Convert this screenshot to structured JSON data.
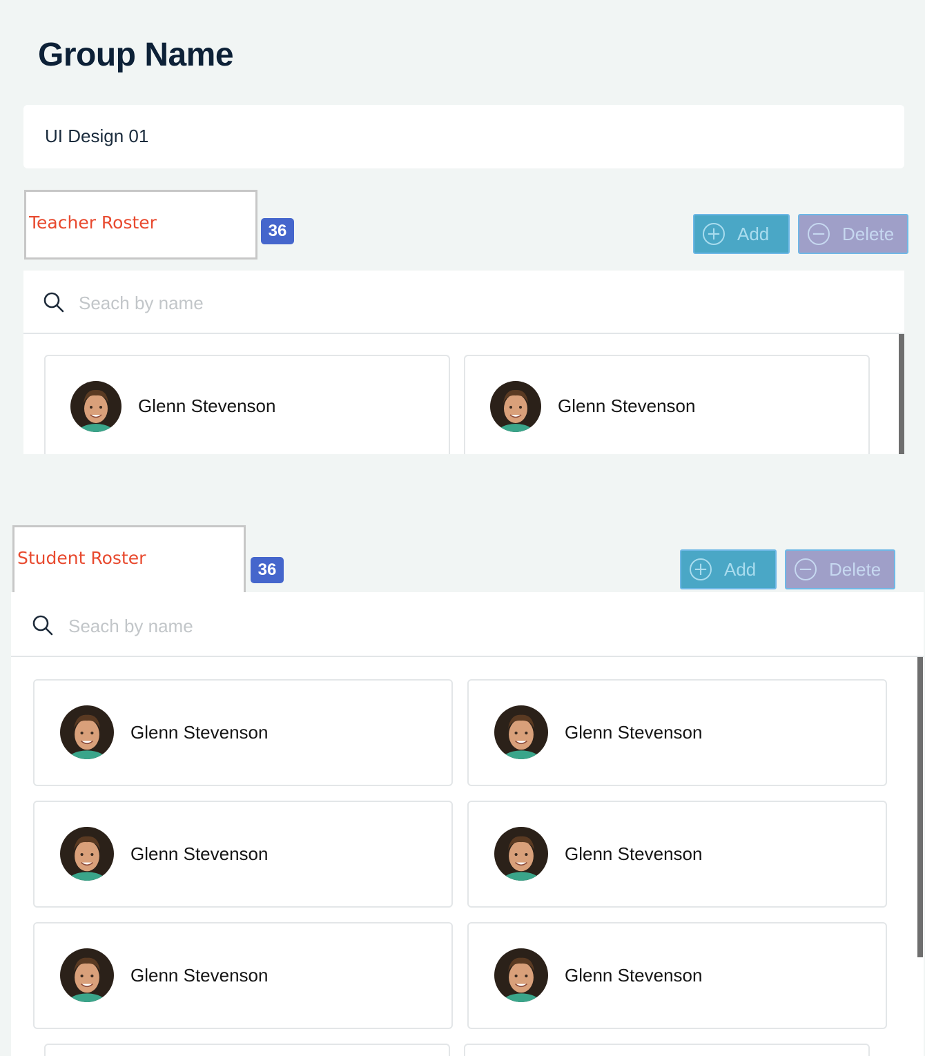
{
  "page": {
    "title": "Group Name"
  },
  "group_name_field": {
    "value": "UI Design 01"
  },
  "teacher_roster": {
    "label": "Teacher Roster",
    "count": "36",
    "add_label": "Add",
    "delete_label": "Delete",
    "search_placeholder": "Seach by name",
    "members": [
      {
        "name": "Glenn Stevenson"
      },
      {
        "name": "Glenn Stevenson"
      }
    ]
  },
  "student_roster": {
    "label": "Student Roster",
    "count": "36",
    "add_label": "Add",
    "delete_label": "Delete",
    "search_placeholder": "Seach by name",
    "members": [
      {
        "name": "Glenn Stevenson"
      },
      {
        "name": "Glenn Stevenson"
      },
      {
        "name": "Glenn Stevenson"
      },
      {
        "name": "Glenn Stevenson"
      },
      {
        "name": "Glenn Stevenson"
      },
      {
        "name": "Glenn Stevenson"
      }
    ]
  },
  "icons": {
    "search": "search-icon",
    "add": "plus-circle-icon",
    "delete": "minus-circle-icon",
    "avatar": "user-avatar"
  },
  "colors": {
    "title": "#0d2137",
    "roster_label": "#e84a2f",
    "badge": "#4566cc",
    "add_button": "#4aa7c6",
    "delete_button": "#9f9fc8",
    "background": "#f1f5f4"
  }
}
